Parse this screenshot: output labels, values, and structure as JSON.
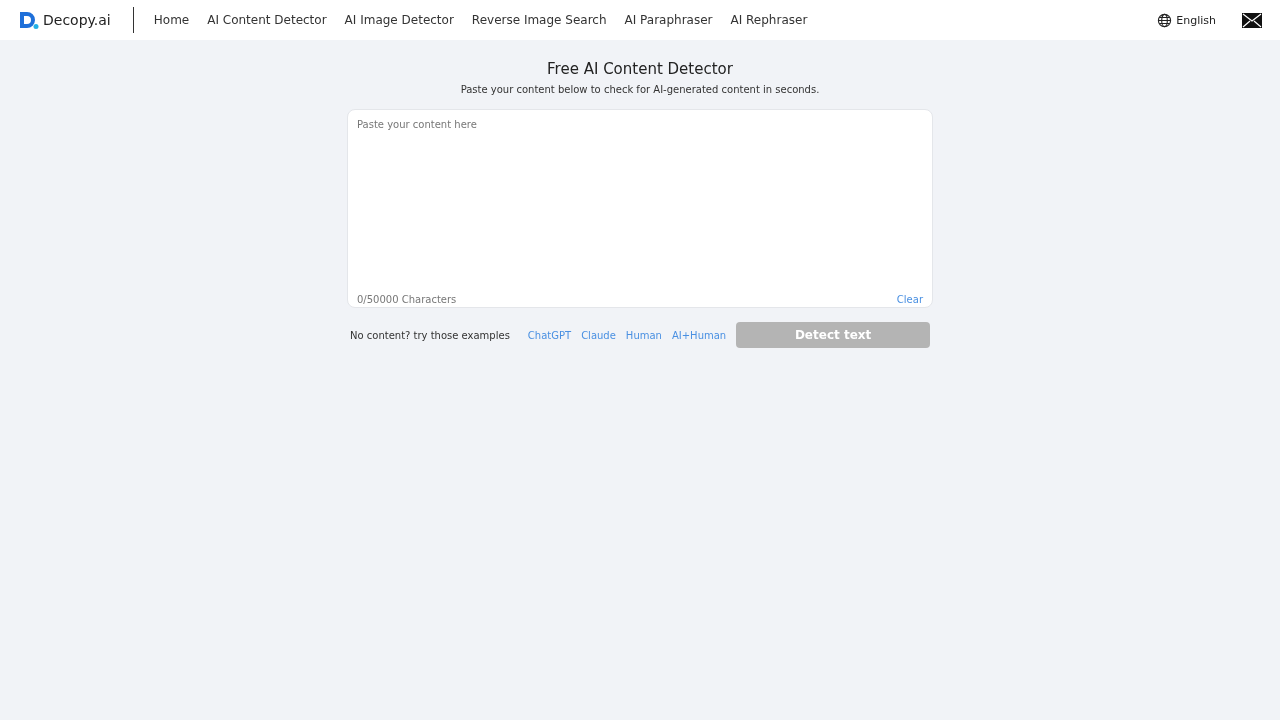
{
  "header": {
    "logo_text": "Decopy.ai",
    "nav": [
      "Home",
      "AI Content Detector",
      "AI Image Detector",
      "Reverse Image Search",
      "AI Paraphraser",
      "AI Rephraser"
    ],
    "language": "English"
  },
  "main": {
    "title": "Free AI Content Detector",
    "subtitle": "Paste your content below to check for AI-generated content in seconds.",
    "editor": {
      "placeholder": "Paste your content here",
      "counter": "0/50000 Characters",
      "clear": "Clear"
    },
    "examples_label": "No content? try those examples",
    "examples": [
      "ChatGPT",
      "Claude",
      "Human",
      "AI+Human"
    ],
    "detect_button": {
      "label": "Detect text",
      "disabled": true
    }
  }
}
